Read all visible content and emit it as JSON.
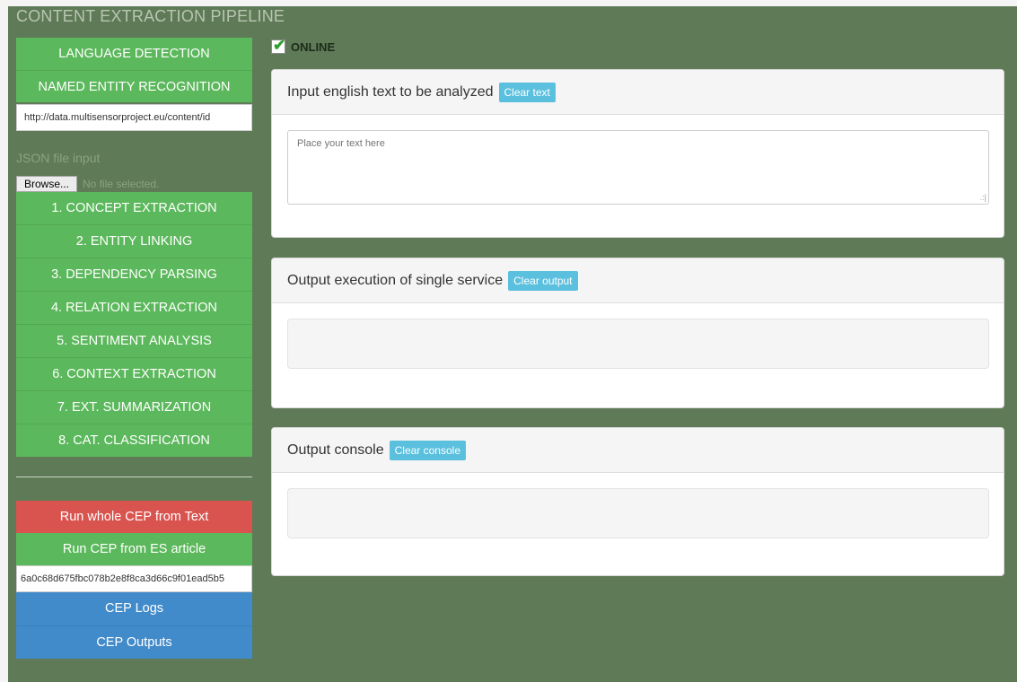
{
  "app": {
    "title": "CONTENT EXTRACTION PIPELINE"
  },
  "sidebar": {
    "language_detection": "LANGUAGE DETECTION",
    "ner": "NAMED ENTITY RECOGNITION",
    "content_url": "http://data.multisensorproject.eu/content/id",
    "json_label": "JSON file input",
    "browse_label": "Browse...",
    "file_status": "No file selected.",
    "steps": [
      {
        "label": "1. CONCEPT EXTRACTION"
      },
      {
        "label": "2. ENTITY LINKING"
      },
      {
        "label": "3. DEPENDENCY PARSING"
      },
      {
        "label": "4. RELATION EXTRACTION"
      },
      {
        "label": "5. SENTIMENT ANALYSIS"
      },
      {
        "label": "6. CONTEXT EXTRACTION"
      },
      {
        "label": "7. EXT. SUMMARIZATION"
      },
      {
        "label": "8. CAT. CLASSIFICATION"
      }
    ],
    "run_text": "Run whole CEP from Text",
    "run_es": "Run CEP from ES article",
    "article_id": "6a0c68d675fbc078b2e8f8ca3d66c9f01ead5b5",
    "logs": "CEP Logs",
    "outputs": "CEP Outputs"
  },
  "status": {
    "online_label": "ONLINE",
    "online_checked": true
  },
  "panels": {
    "input": {
      "title": "Input english text to be analyzed",
      "clear_label": "Clear text",
      "placeholder": "Place your text here"
    },
    "output": {
      "title": "Output execution of single service",
      "clear_label": "Clear output"
    },
    "console": {
      "title": "Output console",
      "clear_label": "Clear console"
    }
  },
  "colors": {
    "background": "#5f7a56",
    "green": "#5cb85c",
    "red": "#d9534f",
    "blue": "#428bca",
    "info": "#5bc0de"
  }
}
